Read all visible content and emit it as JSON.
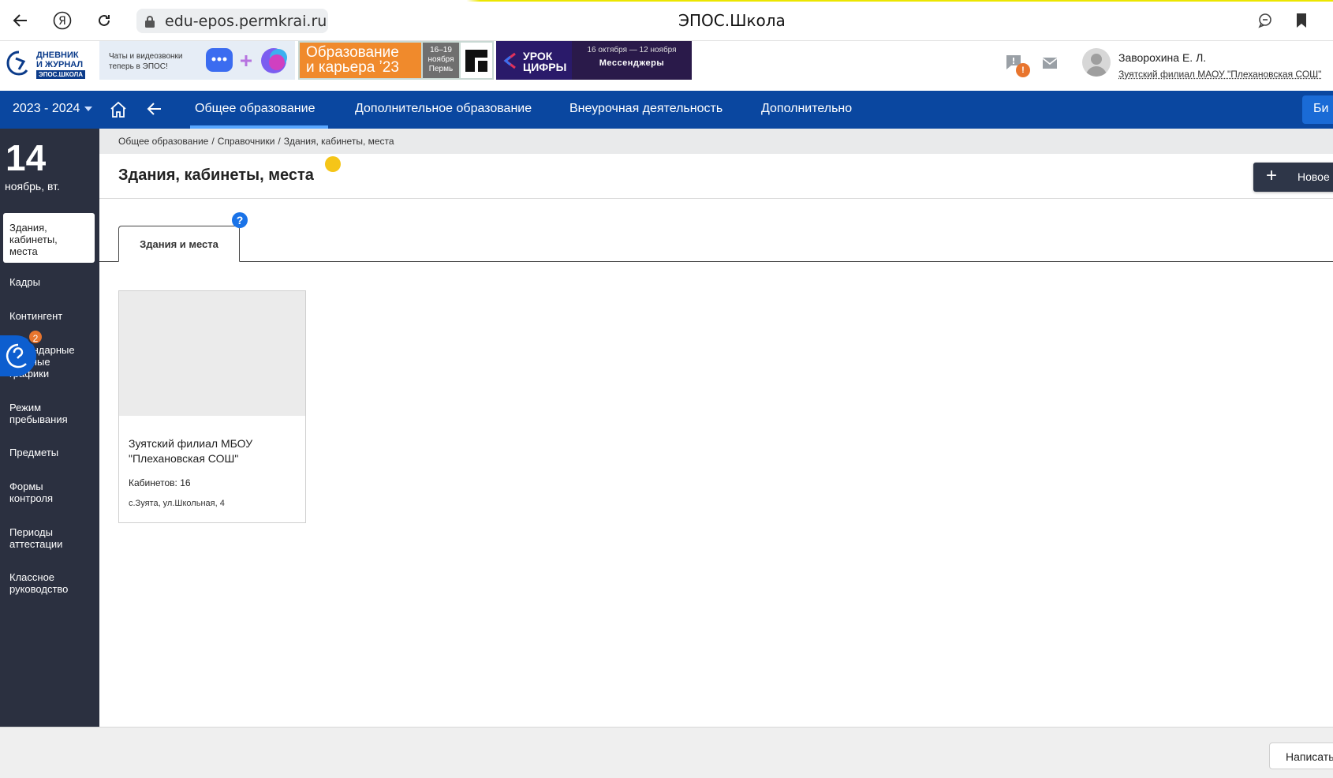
{
  "browser": {
    "url": "edu-epos.permkrai.ru",
    "title": "ЭПОС.Школа"
  },
  "header": {
    "logo_line1": "ДНЕВНИК",
    "logo_line2": "И ЖУРНАЛ",
    "logo_line3": "ЭПОС.ШКОЛА",
    "banner1_text_line1": "Чаты и видеозвонки",
    "banner1_text_line2": "теперь в ЭПОС!",
    "banner2_title_line1": "Образование",
    "banner2_title_line2": "и карьера  ʼ23",
    "banner2_date_line1": "16–19",
    "banner2_date_line2": "ноября",
    "banner2_date_line3": "Пермь",
    "banner3_left_line1": "УРОК",
    "banner3_left_line2": "ЦИФРЫ",
    "banner3_dates": "16 октября — 12 ноября",
    "banner3_topic": "Мессенджеры",
    "notification_badge": "!",
    "user_name": "Заворохина Е. Л.",
    "user_org": "Зуятский филиал МАОУ \"Плехановская СОШ\""
  },
  "nav": {
    "year": "2023 - 2024",
    "items": [
      {
        "label": "Общее образование"
      },
      {
        "label": "Дополнительное образование"
      },
      {
        "label": "Внеурочная деятельность"
      },
      {
        "label": "Дополнительно"
      }
    ],
    "right_button": "Би"
  },
  "sidebar": {
    "day": "14",
    "date_sub": "ноябрь, вт.",
    "active_item": "Здания, кабинеты, места",
    "items": [
      {
        "label": "Кадры"
      },
      {
        "label": "Контингент"
      },
      {
        "label": "Календарные учебные графики"
      },
      {
        "label": "Режим пребывания"
      },
      {
        "label": "Предметы"
      },
      {
        "label": "Формы контроля"
      },
      {
        "label": "Периоды аттестации"
      },
      {
        "label": "Классное руководство"
      }
    ],
    "chat_badge": "2"
  },
  "content": {
    "breadcrumb": [
      "Общее образование",
      "Справочники",
      "Здания, кабинеты, места"
    ],
    "page_title": "Здания, кабинеты, места",
    "new_button": "Новое",
    "tab_label": "Здания и места",
    "help": "?",
    "card": {
      "name": "Зуятский филиал МБОУ \"Плехановская СОШ\"",
      "rooms": "Кабинетов: 16",
      "address": "с.Зуята, ул.Школьная, 4"
    }
  },
  "footer": {
    "write_button": "Написать"
  },
  "colors": {
    "nav_blue": "#0a47a0",
    "sidebar_dark": "#2b3040",
    "accent_orange": "#e8752e",
    "help_blue": "#1a73e8"
  }
}
